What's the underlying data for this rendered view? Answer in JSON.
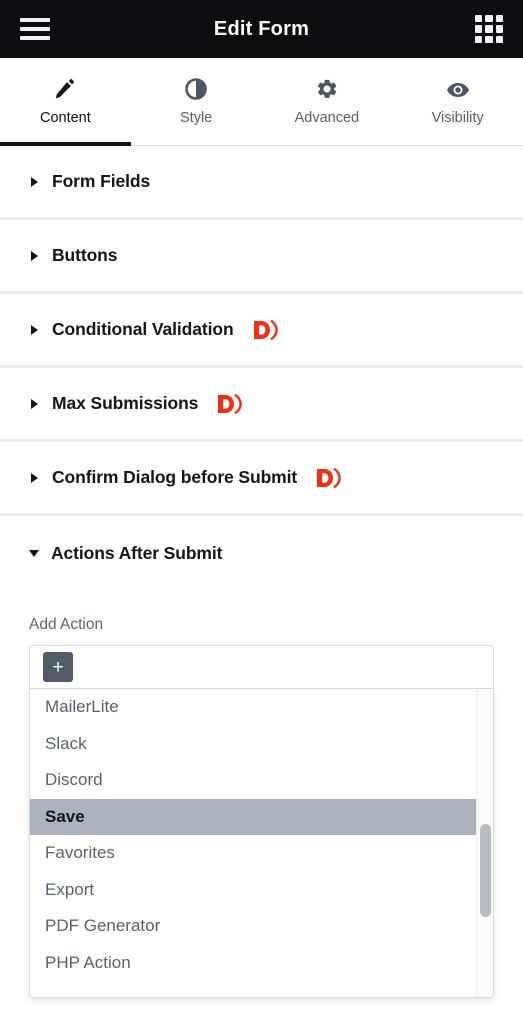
{
  "header": {
    "title": "Edit Form",
    "menu_icon": "hamburger-menu-icon",
    "apps_icon": "grid-apps-icon"
  },
  "tabs": [
    {
      "label": "Content",
      "icon": "pencil-icon",
      "active": true
    },
    {
      "label": "Style",
      "icon": "contrast-circle-icon",
      "active": false
    },
    {
      "label": "Advanced",
      "icon": "gear-icon",
      "active": false
    },
    {
      "label": "Visibility",
      "icon": "eye-icon",
      "active": false
    }
  ],
  "sections": [
    {
      "title": "Form Fields",
      "expanded": false,
      "pro": false
    },
    {
      "title": "Buttons",
      "expanded": false,
      "pro": false
    },
    {
      "title": "Conditional Validation",
      "expanded": false,
      "pro": true
    },
    {
      "title": "Max Submissions",
      "expanded": false,
      "pro": true
    },
    {
      "title": "Confirm Dialog before Submit",
      "expanded": false,
      "pro": true
    },
    {
      "title": "Actions After Submit",
      "expanded": true,
      "pro": false
    }
  ],
  "actions_panel": {
    "field_label": "Add Action",
    "add_button_label": "+",
    "select_value": "",
    "dropdown_open": true,
    "options": [
      {
        "label": "MailerLite",
        "selected": false
      },
      {
        "label": "Slack",
        "selected": false
      },
      {
        "label": "Discord",
        "selected": false
      },
      {
        "label": "Save",
        "selected": true
      },
      {
        "label": "Favorites",
        "selected": false
      },
      {
        "label": "Export",
        "selected": false
      },
      {
        "label": "PDF Generator",
        "selected": false
      },
      {
        "label": "PHP Action",
        "selected": false
      }
    ]
  },
  "colors": {
    "topbar_bg": "#0d0d0f",
    "accent_pro_badge": "#ee3116",
    "selected_option_bg": "#adb3bd",
    "plus_button_bg": "#535b69",
    "divider": "#ebebed",
    "muted_text": "#59616d"
  }
}
